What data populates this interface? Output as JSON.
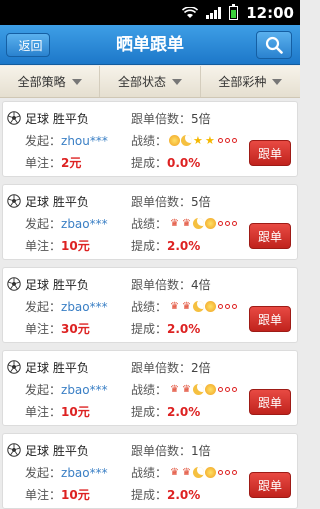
{
  "status_bar": {
    "time": "12:00"
  },
  "title_bar": {
    "back_label": "返回",
    "title": "晒单跟单"
  },
  "filters": [
    "全部策略",
    "全部状态",
    "全部彩种"
  ],
  "labels": {
    "initiator": "发起：",
    "unit_bet": "单注：",
    "follow_multiple": "跟单倍数：",
    "record": "战绩：",
    "commission": "提成：",
    "follow_button": "跟单"
  },
  "cards": [
    {
      "game": "足球 胜平负",
      "user": "zhou***",
      "unit_bet": "2元",
      "multiple": "5倍",
      "commission": "0.0%",
      "record": [
        "sun",
        "moon",
        "star",
        "star",
        "ring",
        "ring",
        "ring"
      ]
    },
    {
      "game": "足球 胜平负",
      "user": "zbao***",
      "unit_bet": "10元",
      "multiple": "5倍",
      "commission": "2.0%",
      "record": [
        "crown",
        "crown",
        "moon",
        "sun",
        "ring",
        "ring",
        "ring"
      ]
    },
    {
      "game": "足球 胜平负",
      "user": "zbao***",
      "unit_bet": "30元",
      "multiple": "4倍",
      "commission": "2.0%",
      "record": [
        "crown",
        "crown",
        "moon",
        "sun",
        "ring",
        "ring",
        "ring"
      ]
    },
    {
      "game": "足球 胜平负",
      "user": "zbao***",
      "unit_bet": "10元",
      "multiple": "2倍",
      "commission": "2.0%",
      "record": [
        "crown",
        "crown",
        "moon",
        "sun",
        "ring",
        "ring",
        "ring"
      ]
    },
    {
      "game": "足球 胜平负",
      "user": "zbao***",
      "unit_bet": "10元",
      "multiple": "1倍",
      "commission": "2.0%",
      "record": [
        "crown",
        "crown",
        "moon",
        "sun",
        "ring",
        "ring",
        "ring"
      ]
    }
  ]
}
